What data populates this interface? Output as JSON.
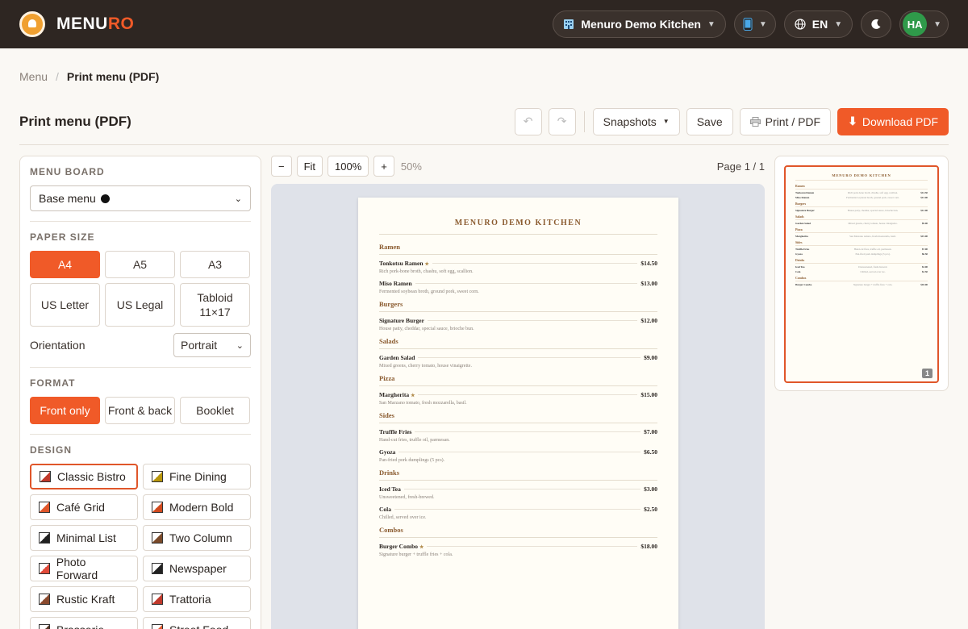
{
  "topbar": {
    "brand_prefix": "MENU",
    "brand_suffix": "RO",
    "restaurant": "Menuro Demo Kitchen",
    "language": "EN",
    "avatar_initials": "HA"
  },
  "breadcrumb": {
    "root": "Menu",
    "separator": "/",
    "current": "Print menu (PDF)"
  },
  "header": {
    "title": "Print menu (PDF)",
    "undo_glyph": "↶",
    "redo_glyph": "↷",
    "snapshots_label": "Snapshots",
    "save_label": "Save",
    "print_label": "Print / PDF",
    "download_label": "Download PDF"
  },
  "panel": {
    "menu_board_label": "MENU BOARD",
    "menu_board_value": "Base menu",
    "paper_size_label": "PAPER SIZE",
    "paper_sizes": [
      "A4",
      "A5",
      "A3",
      "US Letter",
      "US Legal",
      "Tabloid 11×17"
    ],
    "selected_paper": "A4",
    "orientation_label": "Orientation",
    "orientation_value": "Portrait",
    "format_label": "FORMAT",
    "formats": [
      "Front only",
      "Front & back",
      "Booklet"
    ],
    "selected_format": "Front only",
    "design_label": "DESIGN",
    "designs": [
      {
        "name": "Classic Bistro",
        "color": "#c0392b"
      },
      {
        "name": "Fine Dining",
        "color": "#b8960c"
      },
      {
        "name": "Café Grid",
        "color": "#e0562a"
      },
      {
        "name": "Modern Bold",
        "color": "#d14a1e"
      },
      {
        "name": "Minimal List",
        "color": "#222222"
      },
      {
        "name": "Two Column",
        "color": "#7a4a2a"
      },
      {
        "name": "Photo Forward",
        "color": "#e04a3a"
      },
      {
        "name": "Newspaper",
        "color": "#222222"
      },
      {
        "name": "Rustic Kraft",
        "color": "#8a4a2e"
      },
      {
        "name": "Trattoria",
        "color": "#c0392b"
      },
      {
        "name": "Brasserie",
        "color": "#5a3a2a"
      },
      {
        "name": "Street Food",
        "color": "#e0562a"
      }
    ],
    "selected_design": "Classic Bistro"
  },
  "zoom": {
    "minus": "−",
    "fit": "Fit",
    "hundred": "100%",
    "plus": "+",
    "level": "50%",
    "page_indicator": "Page 1 / 1"
  },
  "menu_sheet": {
    "title": "MENURO DEMO KITCHEN",
    "categories": [
      {
        "name": "Ramen",
        "items": [
          {
            "name": "Tonkotsu Ramen",
            "star": true,
            "price": "$14.50",
            "desc": "Rich pork-bone broth, chashu, soft egg, scallion."
          },
          {
            "name": "Miso Ramen",
            "star": false,
            "price": "$13.00",
            "desc": "Fermented soybean broth, ground pork, sweet corn."
          }
        ]
      },
      {
        "name": "Burgers",
        "items": [
          {
            "name": "Signature Burger",
            "star": false,
            "price": "$12.00",
            "desc": "House patty, cheddar, special sauce, brioche bun."
          }
        ]
      },
      {
        "name": "Salads",
        "items": [
          {
            "name": "Garden Salad",
            "star": false,
            "price": "$9.00",
            "desc": "Mixed greens, cherry tomato, house vinaigrette."
          }
        ]
      },
      {
        "name": "Pizza",
        "items": [
          {
            "name": "Margherita",
            "star": true,
            "price": "$15.00",
            "desc": "San Marzano tomato, fresh mozzarella, basil."
          }
        ]
      },
      {
        "name": "Sides",
        "items": [
          {
            "name": "Truffle Fries",
            "star": false,
            "price": "$7.00",
            "desc": "Hand-cut fries, truffle oil, parmesan."
          },
          {
            "name": "Gyoza",
            "star": false,
            "price": "$6.50",
            "desc": "Pan-fried pork dumplings (5 pcs)."
          }
        ]
      },
      {
        "name": "Drinks",
        "items": [
          {
            "name": "Iced Tea",
            "star": false,
            "price": "$3.00",
            "desc": "Unsweetened, fresh-brewed."
          },
          {
            "name": "Cola",
            "star": false,
            "price": "$2.50",
            "desc": "Chilled, served over ice."
          }
        ]
      },
      {
        "name": "Combos",
        "items": [
          {
            "name": "Burger Combo",
            "star": true,
            "price": "$18.00",
            "desc": "Signature burger + truffle fries + cola."
          }
        ]
      }
    ]
  },
  "thumbnail": {
    "page_number": "1"
  },
  "colors": {
    "accent": "#f05a28",
    "topbar": "#2e2622",
    "menu_heading": "#8a5a2e"
  }
}
